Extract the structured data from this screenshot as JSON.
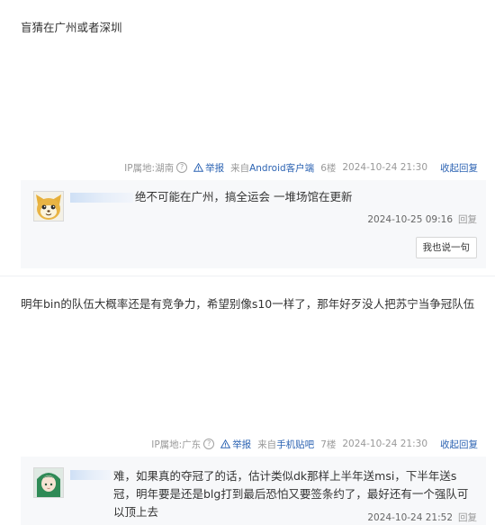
{
  "thread": {
    "posts": [
      {
        "text": "盲猜在广州或者深圳",
        "meta": {
          "ip": "IP属地:湖南",
          "report": "举报",
          "source_prefix": "来自",
          "source_link": "Android客户端",
          "floor": "6楼",
          "datetime": "2024-10-24 21:30",
          "collapse": "收起回复"
        },
        "reply": {
          "text": "绝不可能在广州，搞全运会 一堆场馆在更新",
          "time": "2024-10-25 09:16",
          "reply_label": "回复",
          "say_button": "我也说一句"
        }
      },
      {
        "text": "明年bin的队伍大概率还是有竞争力，希望别像s10一样了，那年好歹没人把苏宁当争冠队伍",
        "meta": {
          "ip": "IP属地:广东",
          "report": "举报",
          "source_prefix": "来自",
          "source_link": "手机贴吧",
          "floor": "7楼",
          "datetime": "2024-10-24 21:30",
          "collapse": "收起回复"
        },
        "reply": {
          "text": "难，如果真的夺冠了的话，估计类似dk那样上半年送msi，下半年送s冠，明年要是还是blg打到最后恐怕又要签条约了，最好还有一个强队可以顶上去",
          "time": "2024-10-24 21:52",
          "reply_label": "回复"
        }
      }
    ]
  },
  "colors": {
    "link": "#2d64b3",
    "muted": "#999999",
    "reply_bg": "#f7f8fa"
  },
  "icons": {
    "help": "help-circle-icon",
    "report": "warning-triangle-icon"
  }
}
